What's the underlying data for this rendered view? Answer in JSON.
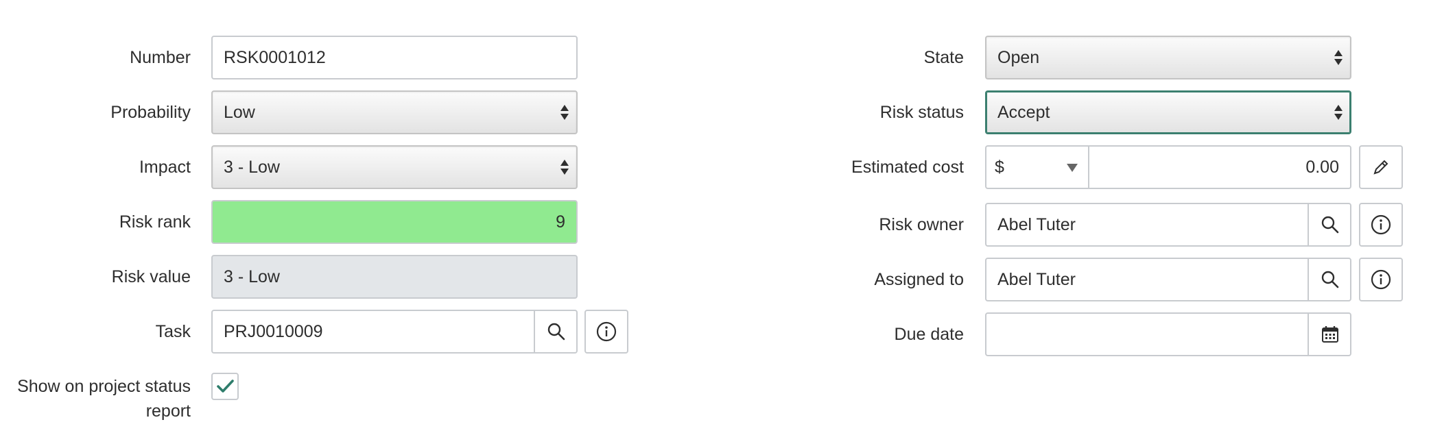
{
  "left": {
    "number": {
      "label": "Number",
      "value": "RSK0001012"
    },
    "probability": {
      "label": "Probability",
      "value": "Low"
    },
    "impact": {
      "label": "Impact",
      "value": "3 - Low"
    },
    "risk_rank": {
      "label": "Risk rank",
      "value": "9",
      "color": "#90ea90"
    },
    "risk_value": {
      "label": "Risk value",
      "value": "3 - Low"
    },
    "task": {
      "label": "Task",
      "value": "PRJ0010009"
    },
    "show_on_report": {
      "label_line1": "Show on project status",
      "label_line2": "report",
      "checked": true
    }
  },
  "right": {
    "state": {
      "label": "State",
      "value": "Open"
    },
    "risk_status": {
      "label": "Risk status",
      "value": "Accept"
    },
    "estimated_cost": {
      "label": "Estimated cost",
      "currency": "$",
      "value": "0.00"
    },
    "risk_owner": {
      "label": "Risk owner",
      "value": "Abel Tuter"
    },
    "assigned_to": {
      "label": "Assigned to",
      "value": "Abel Tuter"
    },
    "due_date": {
      "label": "Due date",
      "value": ""
    }
  },
  "icons": {
    "search": "search-icon",
    "info": "info-icon",
    "pencil": "pencil-icon",
    "calendar": "calendar-icon",
    "check": "checkmark-icon"
  },
  "colors": {
    "accent": "#2e7d6b",
    "rank_bg": "#90ea90",
    "readonly_bg": "#e3e6e9"
  }
}
